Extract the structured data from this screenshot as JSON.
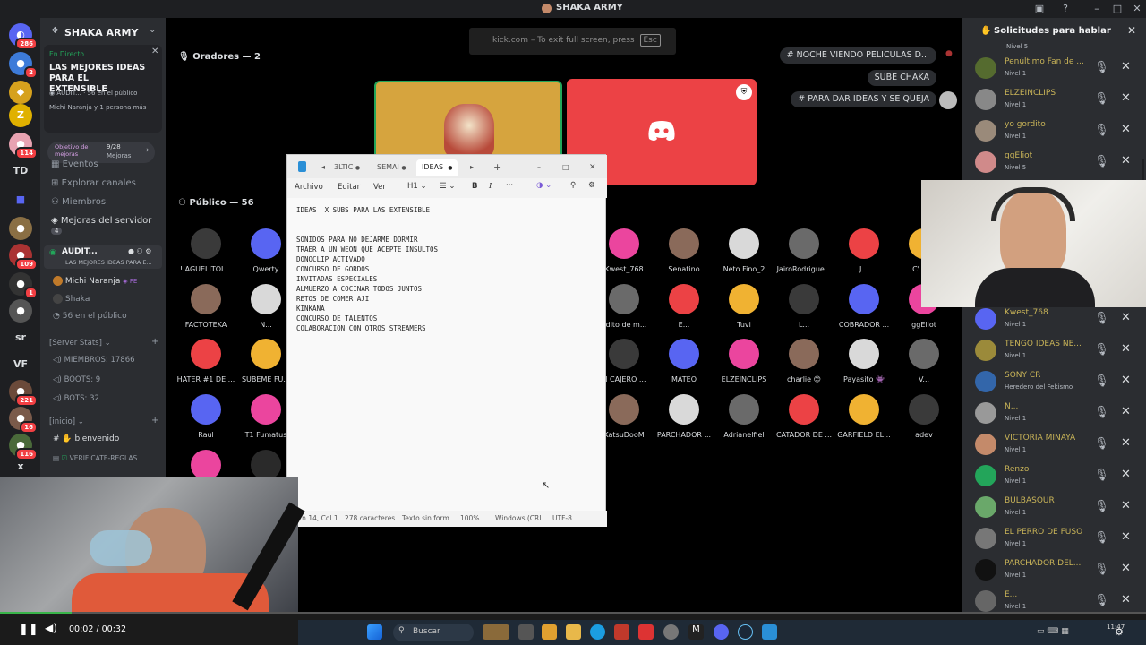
{
  "window": {
    "title": "SHAKA ARMY"
  },
  "server_rail": {
    "badges": [
      "286",
      "2",
      "114",
      "109",
      "1",
      "221",
      "16",
      "116"
    ],
    "letters": [
      "TD",
      "sr",
      "VF",
      "x"
    ]
  },
  "channels": {
    "server_name": "SHAKA ARMY",
    "live_tag": "En Directo",
    "live_title": "LAS MEJORES IDEAS PARA EL EXTENSIBLE",
    "live_channel": "AUDIT...",
    "live_listeners": "56 en el público",
    "live_people": "Michi Naranja y 1 persona más",
    "boost_label": "Objetivo de mejoras",
    "boost_progress": "9/28",
    "boost_unit": "Mejoras",
    "nav": [
      "Eventos",
      "Explorar canales",
      "Miembros",
      "Mejoras del servidor"
    ],
    "nav_badge": "4",
    "voice_channel": "AUDIT...",
    "voice_sub": "LAS MEJORES IDEAS PARA E...",
    "voice_members": [
      "Michi Naranja",
      "Shaka",
      "56 en el público"
    ],
    "category_stats": "Server Stats",
    "stats": [
      "MIEMBROS: 17866",
      "BOOTS: 9",
      "BOTS: 32"
    ],
    "category_inicio": "inicio",
    "text_channels": [
      "bienvenido",
      "VERIFICATE-REGLAS"
    ]
  },
  "stage": {
    "fullscreen_hint": "kick.com – To exit full screen, press",
    "fullscreen_key": "Esc",
    "speakers_label": "Oradores — 2",
    "audience_label": "Público — 56",
    "pills": [
      "# NOCHE VIENDO PELICULAS D...",
      "SUBE CHAKA",
      "# PARA DAR IDEAS Y SE QUEJA"
    ],
    "audience": [
      [
        "! AGUELITOL...",
        "Qwerty",
        "Kwest_768",
        "Senatino",
        "Neto Fino_2",
        "JairoRodrigue...",
        "J...",
        "C' PEC"
      ],
      [
        "FACTOTEKA",
        "N...",
        "bdito de m...",
        "E...",
        "Tuvi",
        "L...",
        "COBRADOR ...",
        "ggEliot"
      ],
      [
        "HATER #1 DE ...",
        "SUBEME FU...",
        "N CAJERO ...",
        "MATEO",
        "ELZEINCLIPS",
        "charlie 😊",
        "Payasito 👾",
        "V..."
      ],
      [
        "Raul",
        "T1 Fumatus",
        "KatsuDooM",
        "PARCHADOR ...",
        "Adrianelfiel",
        "CATADOR DE ...",
        "GARFIELD EL...",
        "adev"
      ]
    ]
  },
  "notepad": {
    "tabs": [
      "3LTIC",
      "SEMAI",
      "IDEAS"
    ],
    "menu": [
      "Archivo",
      "Editar",
      "Ver"
    ],
    "heading": "H1",
    "lines": [
      "IDEAS  X SUBS PARA LAS EXTENSIBLE",
      "",
      "",
      "SONIDOS PARA NO DEJARME DORMIR",
      "TRAER A UN WEON QUE ACEPTE INSULTOS",
      "DONOCLIP ACTIVADO",
      "CONCURSO DE GORDOS",
      "INVITADAS ESPECIALES",
      "ALMUERZO A COCINAR TODOS JUNTOS",
      "RETOS DE COMER AJI",
      "KINKANA",
      "CONCURSO DE TALENTOS",
      "COLABORACION CON OTROS STREAMERS"
    ],
    "status": [
      "Ln 14, Col 1",
      "278 caracteres.",
      "Texto sin form",
      "100%",
      "Windows (CRLF",
      "UTF-8"
    ]
  },
  "requests": {
    "title": "Solicitudes para hablar",
    "top_level": "Nivel 5",
    "items": [
      {
        "name": "Penúltimo Fan de ...",
        "level": "Nivel 1"
      },
      {
        "name": "ELZEINCLIPS",
        "level": "Nivel 1"
      },
      {
        "name": "yo gordito",
        "level": "Nivel 1"
      },
      {
        "name": "ggEliot",
        "level": "Nivel 5"
      },
      {
        "name": "Kwest_768",
        "level": "Nivel 1"
      },
      {
        "name": "TENGO IDEAS NE...",
        "level": "Nivel 1"
      },
      {
        "name": "SONY CR",
        "level": "Heredero del Fekismo"
      },
      {
        "name": "N...",
        "level": "Nivel 1"
      },
      {
        "name": "VICTORIA MINAYA",
        "level": "Nivel 1"
      },
      {
        "name": "Renzo",
        "level": "Nivel 1"
      },
      {
        "name": "BULBASOUR",
        "level": "Nivel 1"
      },
      {
        "name": "EL PERRO DE FUSO",
        "level": "Nivel 1"
      },
      {
        "name": "PARCHADOR DEL...",
        "level": "Nivel 1"
      },
      {
        "name": "E...",
        "level": "Nivel 1"
      }
    ]
  },
  "video": {
    "time": "00:02 / 00:32",
    "progress": 0.0625
  },
  "taskbar": {
    "search": "Buscar",
    "clock": "11:47"
  },
  "colors": {
    "discord_red": "#ec4245",
    "blurple": "#5865f2",
    "pink": "#eb459e",
    "green": "#23a55a"
  }
}
